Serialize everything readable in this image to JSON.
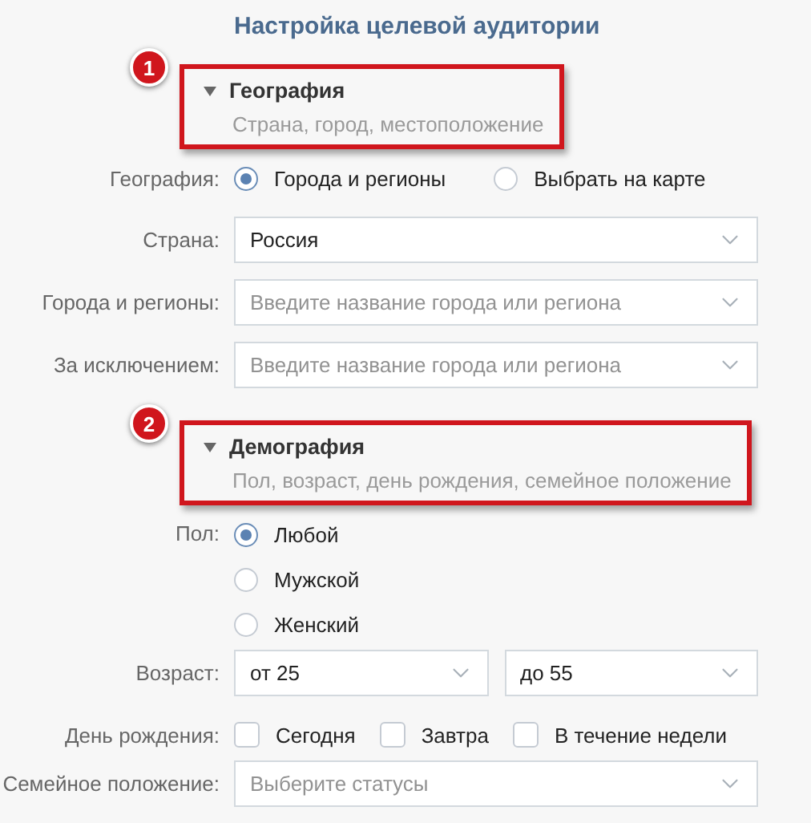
{
  "title": "Настройка целевой аудитории",
  "sections": [
    {
      "marker": "1",
      "title": "География",
      "subtitle": "Страна, город, местоположение",
      "expanded": true,
      "highlighted": true,
      "rows": [
        {
          "kind": "radio-row",
          "label": "География:",
          "options": [
            {
              "label": "Города и регионы",
              "selected": true
            },
            {
              "label": "Выбрать на карте",
              "selected": false
            }
          ]
        },
        {
          "kind": "select",
          "label": "Страна:",
          "fields": [
            {
              "value": "Россия"
            }
          ]
        },
        {
          "kind": "select",
          "label": "Города и регионы:",
          "fields": [
            {
              "placeholder": "Введите название города или региона"
            }
          ]
        },
        {
          "kind": "select",
          "label": "За исключением:",
          "fields": [
            {
              "placeholder": "Введите название города или региона"
            }
          ]
        }
      ]
    },
    {
      "marker": "2",
      "title": "Демография",
      "subtitle": "Пол, возраст, день рождения, семейное положение",
      "expanded": true,
      "highlighted": true,
      "rows": [
        {
          "kind": "radio-list",
          "label": "Пол:",
          "options": [
            {
              "label": "Любой",
              "selected": true
            },
            {
              "label": "Мужской",
              "selected": false
            },
            {
              "label": "Женский",
              "selected": false
            }
          ]
        },
        {
          "kind": "select",
          "label": "Возраст:",
          "fields": [
            {
              "value": "от 25"
            },
            {
              "value": "до 55"
            }
          ]
        },
        {
          "kind": "checkbox",
          "label": "День рождения:",
          "options": [
            {
              "label": "Сегодня",
              "checked": false
            },
            {
              "label": "Завтра",
              "checked": false
            },
            {
              "label": "В течение недели",
              "checked": false
            }
          ]
        },
        {
          "kind": "select",
          "label": "Семейное положение:",
          "fields": [
            {
              "placeholder": "Выберите статусы"
            }
          ]
        }
      ]
    }
  ]
}
